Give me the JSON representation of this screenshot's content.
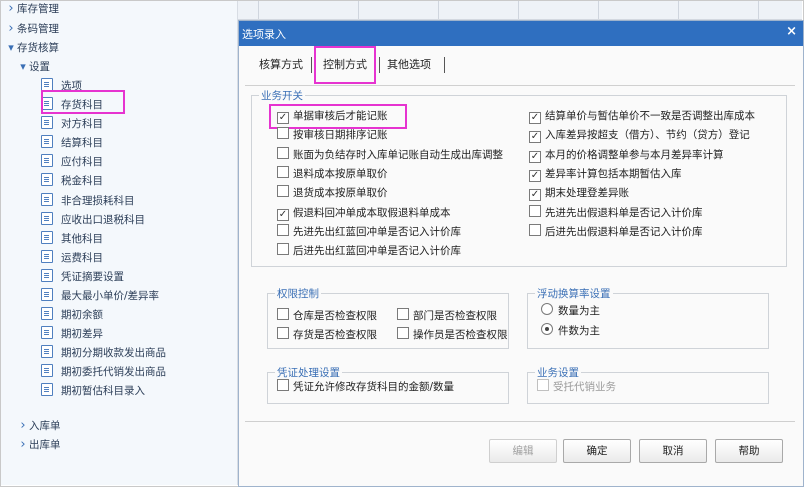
{
  "sidebar": {
    "items": [
      {
        "label": "库存管理",
        "level": 0,
        "expander": "collapsed"
      },
      {
        "label": "条码管理",
        "level": 0,
        "expander": "collapsed"
      },
      {
        "label": "存货核算",
        "level": 0,
        "expander": "expanded"
      },
      {
        "label": "设置",
        "level": 1,
        "expander": "expanded"
      },
      {
        "label": "选项",
        "level": 2,
        "expander": "none",
        "selected": true
      },
      {
        "label": "存货科目",
        "level": 2,
        "expander": "none"
      },
      {
        "label": "对方科目",
        "level": 2,
        "expander": "none"
      },
      {
        "label": "结算科目",
        "level": 2,
        "expander": "none"
      },
      {
        "label": "应付科目",
        "level": 2,
        "expander": "none"
      },
      {
        "label": "税金科目",
        "level": 2,
        "expander": "none"
      },
      {
        "label": "非合理损耗科目",
        "level": 2,
        "expander": "none"
      },
      {
        "label": "应收出口退税科目",
        "level": 2,
        "expander": "none"
      },
      {
        "label": "其他科目",
        "level": 2,
        "expander": "none"
      },
      {
        "label": "运费科目",
        "level": 2,
        "expander": "none"
      },
      {
        "label": "凭证摘要设置",
        "level": 2,
        "expander": "none"
      },
      {
        "label": "最大最小单价/差异率",
        "level": 2,
        "expander": "none"
      },
      {
        "label": "期初余额",
        "level": 2,
        "expander": "none"
      },
      {
        "label": "期初差异",
        "level": 2,
        "expander": "none"
      },
      {
        "label": "期初分期收款发出商品",
        "level": 2,
        "expander": "none"
      },
      {
        "label": "期初委托代销发出商品",
        "level": 2,
        "expander": "none"
      },
      {
        "label": "期初暂估科目录入",
        "level": 2,
        "expander": "none"
      },
      {
        "label": "入库单",
        "level": 1,
        "expander": "collapsed"
      },
      {
        "label": "出库单",
        "level": 1,
        "expander": "collapsed"
      }
    ]
  },
  "dialog": {
    "title": "选项录入",
    "close_glyph": "×",
    "tabs": [
      "核算方式",
      "控制方式",
      "其他选项"
    ],
    "active_tab": "控制方式",
    "business_switch": {
      "label": "业务开关",
      "left": [
        {
          "label": "单据审核后才能记账",
          "checked": true
        },
        {
          "label": "按审核日期排序记账",
          "checked": false
        },
        {
          "label": "账面为负结存时入库单记账自动生成出库调整",
          "checked": false
        },
        {
          "label": "退料成本按原单取价",
          "checked": false
        },
        {
          "label": "退货成本按原单取价",
          "checked": false
        },
        {
          "label": "假退料回冲单成本取假退料单成本",
          "checked": true
        },
        {
          "label": "先进先出红蓝回冲单是否记入计价库",
          "checked": false
        },
        {
          "label": "后进先出红蓝回冲单是否记入计价库",
          "checked": false
        }
      ],
      "right": [
        {
          "label": "结算单价与暂估单价不一致是否调整出库成本",
          "checked": true
        },
        {
          "label": "入库差异按超支（借方）、节约（贷方）登记",
          "checked": true
        },
        {
          "label": "本月的价格调整单参与本月差异率计算",
          "checked": true
        },
        {
          "label": "差异率计算包括本期暂估入库",
          "checked": true
        },
        {
          "label": "期末处理登差异账",
          "checked": true
        },
        {
          "label": "先进先出假退料单是否记入计价库",
          "checked": false
        },
        {
          "label": "后进先出假退料单是否记入计价库",
          "checked": false
        }
      ]
    },
    "permission": {
      "label": "权限控制",
      "items": [
        {
          "label": "仓库是否检查权限",
          "checked": false
        },
        {
          "label": "部门是否检查权限",
          "checked": false
        },
        {
          "label": "存货是否检查权限",
          "checked": false
        },
        {
          "label": "操作员是否检查权限",
          "checked": false
        }
      ]
    },
    "exchange_rate": {
      "label": "浮动换算率设置",
      "options": [
        "数量为主",
        "件数为主"
      ],
      "selected": "件数为主"
    },
    "voucher": {
      "label": "凭证处理设置",
      "items": [
        {
          "label": "凭证允许修改存货科目的金额/数量",
          "checked": false
        }
      ]
    },
    "business_settings": {
      "label": "业务设置",
      "items": [
        {
          "label": "受托代销业务",
          "checked": false,
          "disabled": true
        }
      ]
    },
    "buttons": [
      {
        "label": "编辑",
        "disabled": true
      },
      {
        "label": "确定",
        "disabled": false
      },
      {
        "label": "取消",
        "disabled": false
      },
      {
        "label": "帮助",
        "disabled": false
      }
    ]
  },
  "colors": {
    "accent": "#2f6fc0",
    "highlight": "#e633d0",
    "group_label": "#3a6fb5"
  }
}
